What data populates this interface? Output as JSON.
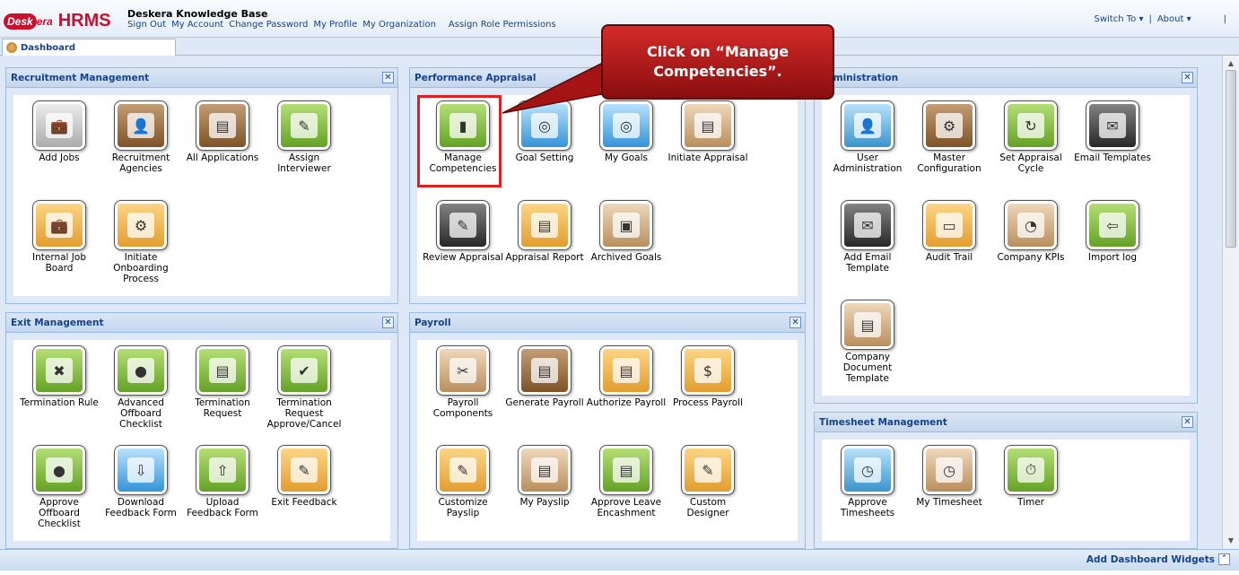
{
  "header": {
    "logo_badge": "Desk",
    "logo_rest": "era",
    "logo_hrms": "HRMS",
    "kb_title": "Deskera Knowledge Base",
    "links": [
      "Sign Out",
      "My Account",
      "Change Password",
      "My Profile",
      "My Organization",
      "Assign Role Permissions"
    ],
    "switch_to": "Switch To",
    "about": "About",
    "separator": "|"
  },
  "tabs": {
    "dashboard": "Dashboard"
  },
  "callout": {
    "line1": "Click on “Manage",
    "line2": "Competencies”."
  },
  "panels": {
    "recruitment": {
      "title": "Recruitment Management",
      "items": [
        "Add Jobs",
        "Recruitment Agencies",
        "All Applications",
        "Assign Interviewer",
        "Internal Job Board",
        "Initiate Onboarding Process"
      ]
    },
    "performance": {
      "title": "Performance Appraisal",
      "items": [
        "Manage Competencies",
        "Goal Setting",
        "My Goals",
        "Initiate Appraisal",
        "Review Appraisal",
        "Appraisal Report",
        "Archived Goals"
      ]
    },
    "administration": {
      "title": "Administration",
      "items": [
        "User Administration",
        "Master Configuration",
        "Set Appraisal Cycle",
        "Email Templates",
        "Add Email Template",
        "Audit Trail",
        "Company KPIs",
        "Import log",
        "Company Document Template"
      ]
    },
    "exit": {
      "title": "Exit Management",
      "items": [
        "Termination Rule",
        "Advanced Offboard Checklist",
        "Termination Request",
        "Termination Request Approve/Cancel",
        "Approve Offboard Checklist",
        "Download Feedback Form",
        "Upload Feedback Form",
        "Exit Feedback"
      ]
    },
    "payroll": {
      "title": "Payroll",
      "items": [
        "Payroll Components",
        "Generate Payroll",
        "Authorize Payroll",
        "Process Payroll",
        "Customize Payslip",
        "My Payslip",
        "Approve Leave Encashment",
        "Custom Designer"
      ]
    },
    "timesheet": {
      "title": "Timesheet Management",
      "items": [
        "Approve Timesheets",
        "My Timesheet",
        "Timer"
      ]
    }
  },
  "footer": {
    "add_widgets": "Add Dashboard Widgets"
  },
  "close_glyph": "✕",
  "icons": {
    "recruitment": [
      "briefcase-add-icon",
      "agency-person-icon",
      "applications-list-icon",
      "assign-clipboard-icon",
      "job-board-icon",
      "onboarding-people-icon"
    ],
    "performance": [
      "competencies-chart-icon",
      "target-icon",
      "goals-target-icon",
      "initiate-notebook-icon",
      "review-notebook-icon",
      "report-notebook-icon",
      "archive-box-icon"
    ],
    "administration": [
      "user-admin-icon",
      "gear-config-icon",
      "cycle-clock-icon",
      "email-template-icon",
      "add-email-icon",
      "folder-audit-icon",
      "gauge-kpi-icon",
      "import-arrow-icon",
      "documents-icon"
    ],
    "exit": [
      "termination-rule-icon",
      "offboard-checklist-icon",
      "termination-request-icon",
      "request-approve-icon",
      "approve-offboard-icon",
      "download-form-icon",
      "upload-form-icon",
      "exit-feedback-icon"
    ],
    "payroll": [
      "tools-components-icon",
      "generate-payroll-icon",
      "authorize-payroll-icon",
      "process-payroll-icon",
      "customize-payslip-icon",
      "payslip-icon",
      "leave-encashment-icon",
      "custom-designer-icon"
    ],
    "timesheet": [
      "approve-timesheet-icon",
      "my-timesheet-icon",
      "stopwatch-icon"
    ]
  },
  "colors": {
    "accent": "#15428b",
    "highlight": "#e02020",
    "callout": "#b21a1a",
    "brand": "#c8102e"
  }
}
